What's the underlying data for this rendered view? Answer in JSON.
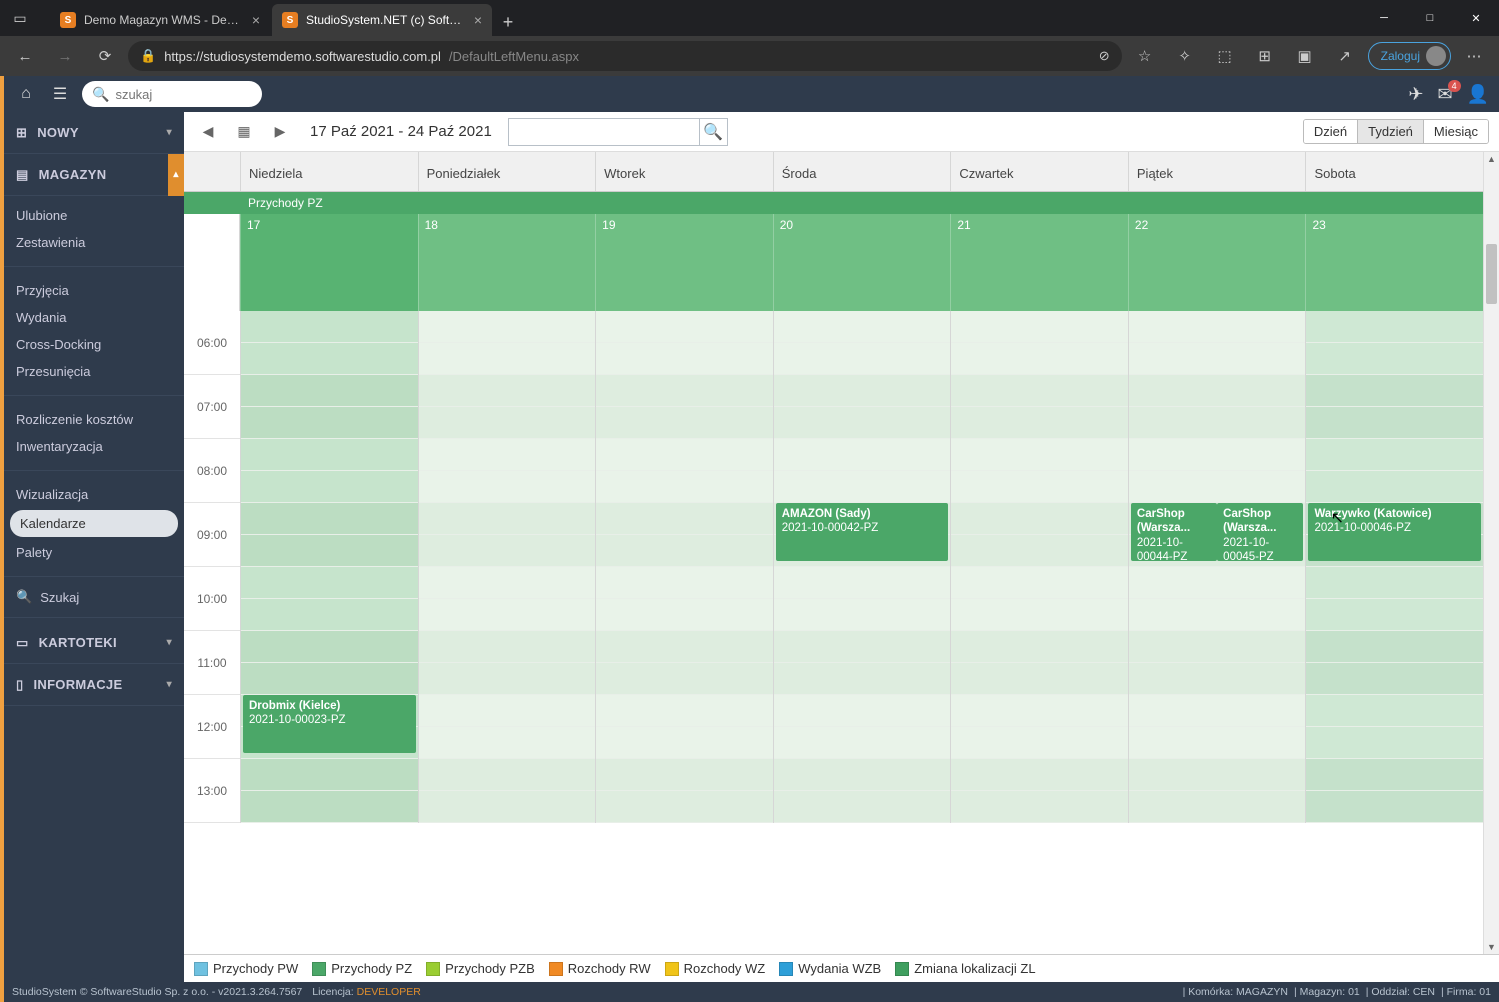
{
  "browser": {
    "tabs": [
      {
        "label": "Demo Magazyn WMS - Demo o",
        "active": false
      },
      {
        "label": "StudioSystem.NET (c) SoftwareSt",
        "active": true
      }
    ],
    "url_host": "https://studiosystemdemo.softwarestudio.com.pl",
    "url_path": "/DefaultLeftMenu.aspx",
    "login": "Zaloguj"
  },
  "topbar": {
    "search_placeholder": "szukaj",
    "mail_badge": "4"
  },
  "sidebar": {
    "new": "NOWY",
    "sections": {
      "magazyn": "MAGAZYN",
      "kartoteki": "KARTOTEKI",
      "informacje": "INFORMACJE"
    },
    "groups": [
      [
        "Ulubione",
        "Zestawienia"
      ],
      [
        "Przyjęcia",
        "Wydania",
        "Cross-Docking",
        "Przesunięcia"
      ],
      [
        "Rozliczenie kosztów",
        "Inwentaryzacja"
      ],
      [
        "Wizualizacja",
        "Kalendarze",
        "Palety"
      ]
    ],
    "active_item": "Kalendarze",
    "szukaj": "Szukaj"
  },
  "toolbar": {
    "range": "17 Paź 2021 - 24 Paź 2021",
    "views": {
      "day": "Dzień",
      "week": "Tydzień",
      "month": "Miesiąc"
    }
  },
  "calendar": {
    "banner": "Przychody PZ",
    "days": [
      "Niedziela",
      "Poniedziałek",
      "Wtorek",
      "Środa",
      "Czwartek",
      "Piątek",
      "Sobota"
    ],
    "dates": [
      "17",
      "18",
      "19",
      "20",
      "21",
      "22",
      "23"
    ],
    "hours": [
      "06:00",
      "07:00",
      "08:00",
      "09:00",
      "10:00",
      "11:00",
      "12:00",
      "13:00"
    ],
    "events": [
      {
        "day": 0,
        "hour_idx": 6,
        "span": 1,
        "title": "Drobmix (Kielce)",
        "code": "2021-10-00023-PZ"
      },
      {
        "day": 3,
        "hour_idx": 3,
        "span": 1,
        "title": "AMAZON (Sady)",
        "code": "2021-10-00042-PZ"
      },
      {
        "day": 5,
        "hour_idx": 3,
        "span": 1,
        "half": "l",
        "title": "CarShop (Warsza...",
        "code": "2021-10-00044-PZ"
      },
      {
        "day": 5,
        "hour_idx": 3,
        "span": 1,
        "half": "r",
        "title": "CarShop (Warsza...",
        "code": "2021-10-00045-PZ"
      },
      {
        "day": 6,
        "hour_idx": 3,
        "span": 1,
        "title": "Warzywko (Katowice)",
        "code": "2021-10-00046-PZ"
      }
    ]
  },
  "legend": [
    {
      "label": "Przychody PW",
      "color": "#6fc1e0"
    },
    {
      "label": "Przychody PZ",
      "color": "#4ba768"
    },
    {
      "label": "Przychody PZB",
      "color": "#9acd32"
    },
    {
      "label": "Rozchody RW",
      "color": "#f08a24"
    },
    {
      "label": "Rozchody WZ",
      "color": "#f0c419"
    },
    {
      "label": "Wydania WZB",
      "color": "#2e9fd8"
    },
    {
      "label": "Zmiana lokalizacji ZL",
      "color": "#3f9f5f"
    }
  ],
  "statusbar": {
    "left": "StudioSystem © SoftwareStudio Sp. z o.o. - v2021.3.264.7567",
    "lic_lbl": "Licencja:",
    "lic_val": "DEVELOPER",
    "right": [
      "Komórka: MAGAZYN",
      "Magazyn: 01",
      "Oddział: CEN",
      "Firma: 01"
    ]
  }
}
